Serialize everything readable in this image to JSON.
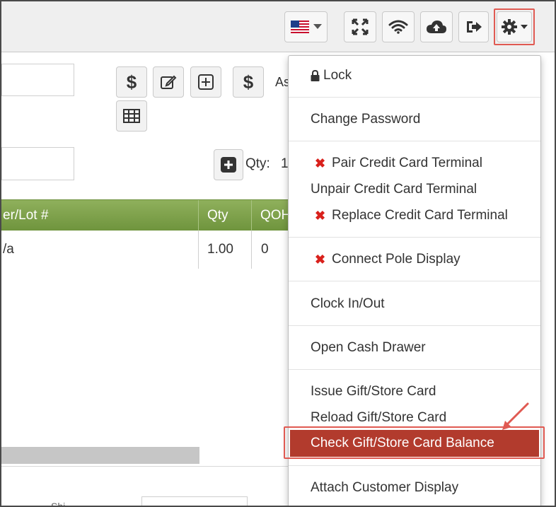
{
  "topbar": {
    "icons": [
      "us-flag-icon",
      "fullscreen-icon",
      "wifi-icon",
      "cloud-upload-icon",
      "logout-icon",
      "gear-icon"
    ]
  },
  "toolbar": {
    "as_text": "As",
    "qty_label": "Qty:",
    "qty_value": "1"
  },
  "table": {
    "headers": [
      "er/Lot #",
      "Qty",
      "QOH"
    ],
    "row": {
      "lot": "/a",
      "qty": "1.00",
      "qoh": "0"
    }
  },
  "bottom": {
    "partial_text": "Shi"
  },
  "menu": {
    "lock": "Lock",
    "change_password": "Change Password",
    "pair_terminal": "Pair Credit Card Terminal",
    "unpair_terminal": "Unpair Credit Card Terminal",
    "replace_terminal": "Replace Credit Card Terminal",
    "connect_pole": "Connect Pole Display",
    "clock": "Clock In/Out",
    "open_drawer": "Open Cash Drawer",
    "issue_gift": "Issue Gift/Store Card",
    "reload_gift": "Reload Gift/Store Card",
    "check_gift": "Check Gift/Store Card Balance",
    "attach_display": "Attach Customer Display"
  },
  "colors": {
    "accent_highlight": "#e05a52",
    "active_item": "#b23b2d",
    "table_header": "#7a9e47",
    "qoh_warning": "#f08a85",
    "error_x": "#d9211c"
  }
}
